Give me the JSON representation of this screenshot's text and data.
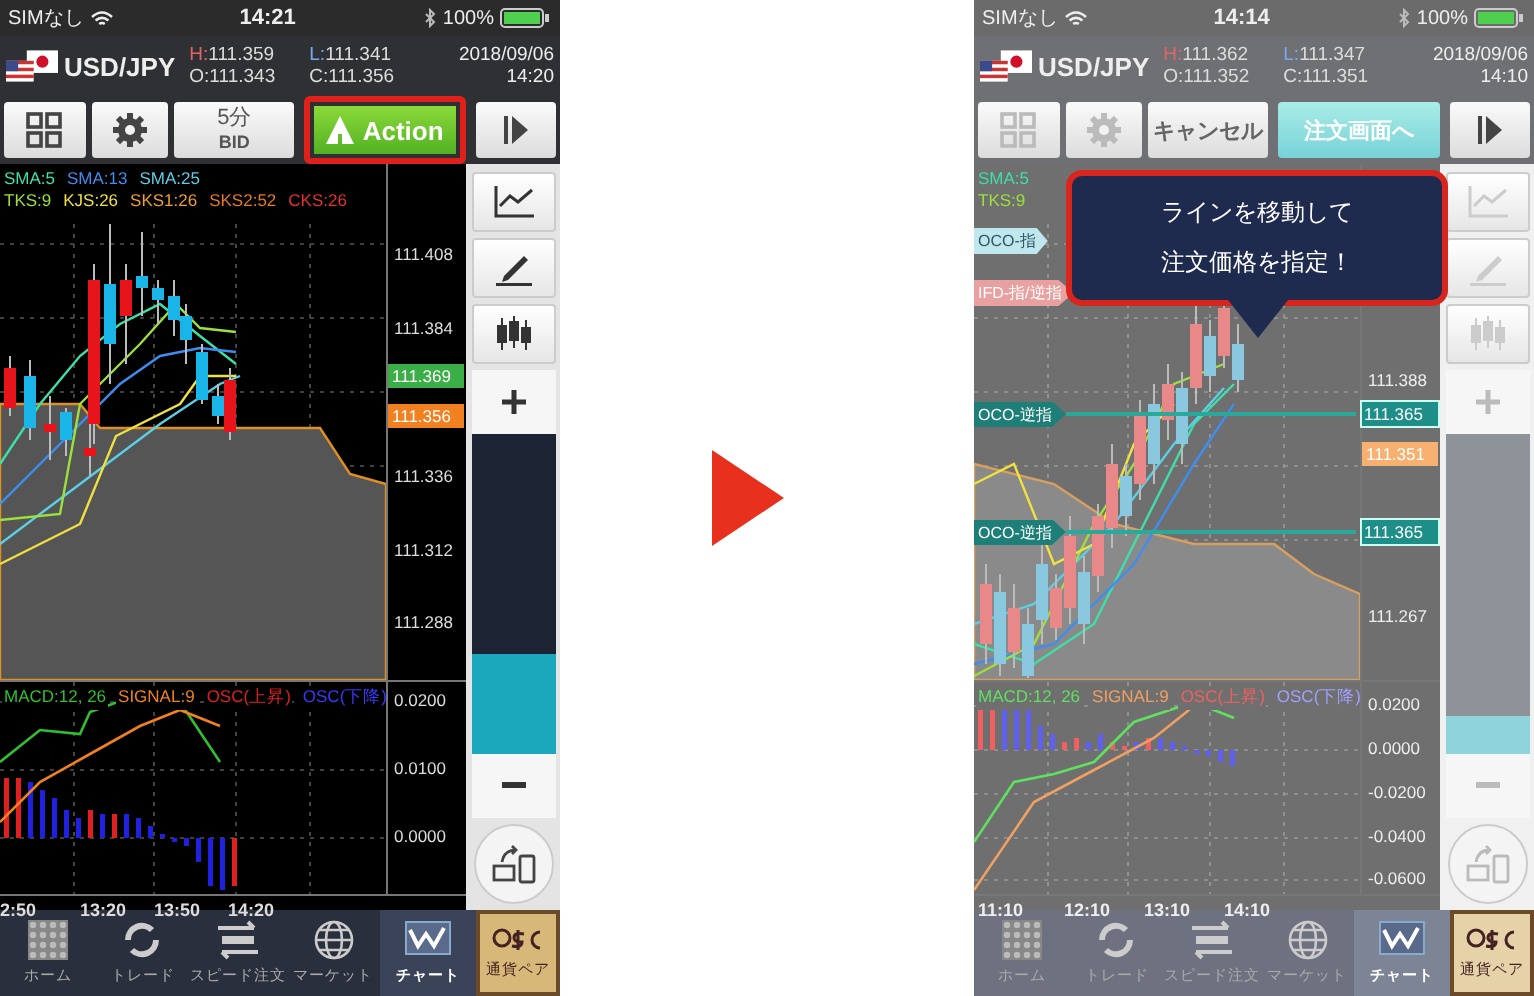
{
  "phones": [
    {
      "dimmed": false,
      "status": {
        "carrier": "SIMなし",
        "time": "14:21",
        "battery": "100%"
      },
      "pair": "USD/JPY",
      "quote": [
        {
          "label": "H:",
          "value": "111.359"
        },
        {
          "label": "L:",
          "value": "111.341"
        },
        {
          "label": "O:",
          "value": "111.343"
        },
        {
          "label": "C:",
          "value": "111.356"
        }
      ],
      "date": "2018/09/06",
      "clock": "14:20",
      "toolbar": [
        {
          "kind": "grid",
          "disabled": false
        },
        {
          "kind": "gear",
          "disabled": false
        },
        {
          "kind": "interval",
          "label": "5分",
          "sublabel": "BID"
        },
        {
          "kind": "action",
          "label": "Action",
          "highlighted": true
        },
        {
          "kind": "next"
        }
      ],
      "legend": [
        [
          {
            "text": "SMA:5",
            "color": "#3de0a8"
          },
          {
            "text": "SMA:13",
            "color": "#3d8ef0"
          },
          {
            "text": "SMA:25",
            "color": "#5ccfe6"
          }
        ],
        [
          {
            "text": "TKS:9",
            "color": "#9be03c"
          },
          {
            "text": "KJS:26",
            "color": "#f0e040"
          },
          {
            "text": "SKS1:26",
            "color": "#f0a030"
          },
          {
            "text": "SKS2:52",
            "color": "#e87a20"
          },
          {
            "text": "CKS:26",
            "color": "#e83030"
          }
        ]
      ],
      "price_ticks": [
        "111.408",
        "111.384",
        "111.336",
        "111.312",
        "111.288"
      ],
      "price_tags": [
        {
          "text": "111.369",
          "color": "#3cae48"
        },
        {
          "text": "111.356",
          "color": "#f08020"
        }
      ],
      "macd_legend": [
        {
          "text": "MACD:12, 26",
          "color": "#30c030"
        },
        {
          "text": "SIGNAL:9",
          "color": "#f08020"
        },
        {
          "text": "OSC(上昇)",
          "color": "#e02020"
        },
        {
          "text": "OSC(下降)",
          "color": "#3838ff"
        }
      ],
      "macd_ticks": [
        "0.0200",
        "0.0100",
        "0.0000"
      ],
      "time_labels": [
        "2:50",
        "13:20",
        "13:50",
        "14:20"
      ],
      "side_tools_disabled": false,
      "zoom": {
        "level": 0.31
      },
      "nav": [
        {
          "kind": "home",
          "label": "ホーム",
          "selected": false
        },
        {
          "kind": "trade",
          "label": "トレード",
          "selected": false
        },
        {
          "kind": "speed",
          "label": "スピード注文",
          "selected": false
        },
        {
          "kind": "market",
          "label": "マーケット",
          "selected": false
        },
        {
          "kind": "chart",
          "label": "チャート",
          "selected": true
        },
        {
          "kind": "pairs",
          "label": "通貨ペア",
          "selected": false
        }
      ]
    },
    {
      "dimmed": true,
      "status": {
        "carrier": "SIMなし",
        "time": "14:14",
        "battery": "100%"
      },
      "pair": "USD/JPY",
      "quote": [
        {
          "label": "H:",
          "value": "111.362"
        },
        {
          "label": "L:",
          "value": "111.347"
        },
        {
          "label": "O:",
          "value": "111.352"
        },
        {
          "label": "C:",
          "value": "111.351"
        }
      ],
      "date": "2018/09/06",
      "clock": "14:10",
      "toolbar": [
        {
          "kind": "grid",
          "disabled": true
        },
        {
          "kind": "gear",
          "disabled": true
        },
        {
          "kind": "cancel",
          "label": "キャンセル"
        },
        {
          "kind": "order",
          "label": "注文画面へ"
        },
        {
          "kind": "next"
        }
      ],
      "legend": [
        [
          {
            "text": "SMA:5",
            "color": "#3de0a8"
          }
        ],
        [
          {
            "text": "TKS:9",
            "color": "#9be03c"
          }
        ]
      ],
      "price_ticks": [
        "111.388",
        "111.267"
      ],
      "price_tags": [
        {
          "text": "111.351",
          "color": "#f7b070"
        }
      ],
      "order_lines": [
        {
          "kind": "tab",
          "label": "OCO-指"
        },
        {
          "kind": "tab",
          "label": "IFD-指/逆指"
        },
        {
          "kind": "line",
          "label": "OCO-逆指",
          "price": "111.365"
        },
        {
          "kind": "line",
          "label": "OCO-逆指",
          "price": "111.365"
        }
      ],
      "tooltip": [
        "ラインを移動して",
        "注文価格を指定！"
      ],
      "macd_legend": [
        {
          "text": "MACD:12, 26",
          "color": "#60e060"
        },
        {
          "text": "SIGNAL:9",
          "color": "#f0a060"
        },
        {
          "text": "OSC(上昇)",
          "color": "#f06060"
        },
        {
          "text": "OSC(下降)",
          "color": "#a0a0ff"
        }
      ],
      "macd_ticks": [
        "0.0200",
        "0.0000",
        "-0.0200",
        "-0.0400",
        "-0.0600"
      ],
      "time_labels": [
        "11:10",
        "12:10",
        "13:10",
        "14:10"
      ],
      "side_tools_disabled": true,
      "zoom": {
        "level": 0.12
      },
      "nav": [
        {
          "kind": "home",
          "label": "ホーム",
          "selected": false
        },
        {
          "kind": "trade",
          "label": "トレード",
          "selected": false
        },
        {
          "kind": "speed",
          "label": "スピード注文",
          "selected": false
        },
        {
          "kind": "market",
          "label": "マーケット",
          "selected": false
        },
        {
          "kind": "chart",
          "label": "チャート",
          "selected": true
        },
        {
          "kind": "pairs",
          "label": "通貨ペア",
          "selected": false
        }
      ]
    }
  ]
}
